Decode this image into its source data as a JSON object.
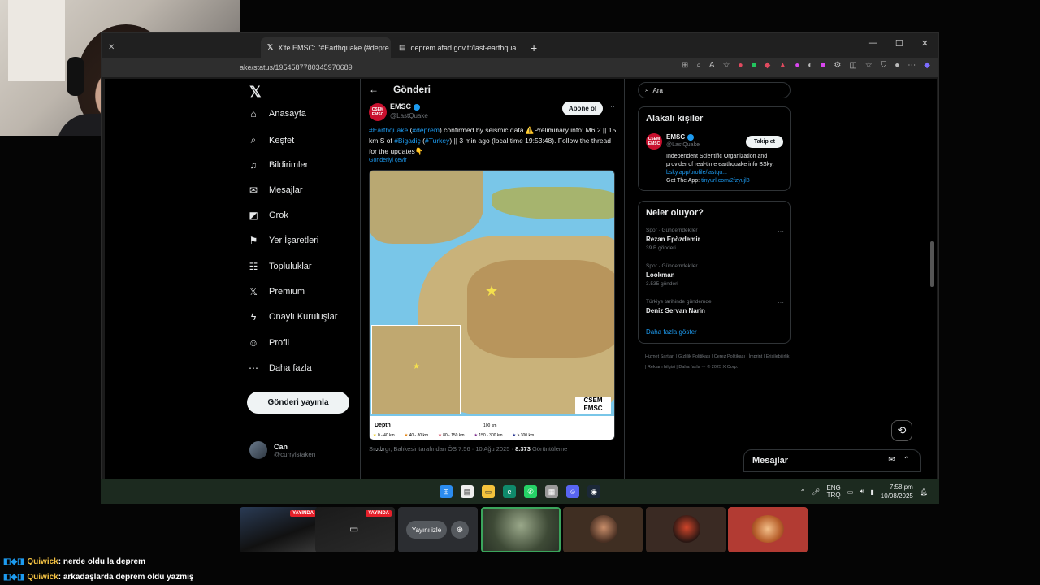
{
  "browser": {
    "tabs": [
      {
        "label": "X'te EMSC: \"#Earthquake (#depre",
        "active": true
      },
      {
        "label": "deprem.afad.gov.tr/last-earthqua",
        "active": false
      }
    ],
    "url": "ake/status/1954587780345970689"
  },
  "x": {
    "nav": [
      {
        "label": "Anasayfa",
        "icon": "home-icon"
      },
      {
        "label": "Keşfet",
        "icon": "search-icon"
      },
      {
        "label": "Bildirimler",
        "icon": "bell-icon"
      },
      {
        "label": "Mesajlar",
        "icon": "mail-icon"
      },
      {
        "label": "Grok",
        "icon": "grok-icon"
      },
      {
        "label": "Yer İşaretleri",
        "icon": "bookmark-icon"
      },
      {
        "label": "Topluluklar",
        "icon": "people-icon"
      },
      {
        "label": "Premium",
        "icon": "x-logo-icon"
      },
      {
        "label": "Onaylı Kuruluşlar",
        "icon": "lightning-icon"
      },
      {
        "label": "Profil",
        "icon": "person-icon"
      },
      {
        "label": "Daha fazla",
        "icon": "more-circle-icon"
      }
    ],
    "post_button": "Gönderi yayınla",
    "account": {
      "name": "Can",
      "handle": "@curryistaken"
    },
    "header_title": "Gönderi",
    "tweet": {
      "author": "EMSC",
      "handle": "@LastQuake",
      "avatar_text": "CSEM EMSC",
      "follow_label": "Abone ol",
      "text": {
        "tag1": "#Earthquake",
        "tag2": "#deprem",
        "part1": " confirmed by seismic data.⚠️Preliminary info: M6.2 || 15 km S of ",
        "tag3": "#Bigadiç",
        "tag4": "#Turkey",
        "part2": " || 3 min ago (local time 19:53:48). Follow the thread for the updates👇"
      },
      "translate": "Gönderiyi çevir",
      "map": {
        "logo": "CSEM EMSC",
        "legend_title": "Depth",
        "scale": "100 km",
        "legend": [
          "0 - 40 km",
          "40 - 80 km",
          "80 - 150 km",
          "150 - 300 km",
          "> 300 km"
        ]
      },
      "meta_location": "Sındırgı, Balıkesir tarafından ÖS 7:56 · 10 Ağu 2025 · ",
      "views_count": "8.373",
      "views_label": " Görüntüleme"
    },
    "search_placeholder": "Ara",
    "related": {
      "title": "Alakalı kişiler",
      "name": "EMSC",
      "handle": "@LastQuake",
      "follow_label": "Takip et",
      "bio1": "Independent Scientific Organization and provider of real-time earthquake info BSky: ",
      "bio_link": "bsky.app/profile/lastqu...",
      "bio2": "Get The App: ",
      "app_link": "tinyurl.com/2fzyujl8"
    },
    "trends": {
      "title": "Neler oluyor?",
      "items": [
        {
          "category": "Spor · Gündemdekiler",
          "name": "Rezan Epözdemir",
          "count": "39 B gönderi"
        },
        {
          "category": "Spor · Gündemdekiler",
          "name": "Lookman",
          "count": "3.535 gönderi"
        },
        {
          "category": "Türkiye tarihinde gündemde",
          "name": "Deniz Servan Narin",
          "count": ""
        }
      ],
      "show_more": "Daha fazla göster"
    },
    "footer": "Hizmet Şartları | Gizlilik Politikası | Çerez Politikası | İmprint | Erişilebilirlik | Reklam bilgisi | Daha fazla ··· © 2025 X Corp.",
    "messages": "Mesajlar"
  },
  "taskbar": {
    "lang1": "ENG",
    "lang2": "TRQ",
    "time": "7:58 pm",
    "date": "10/08/2025"
  },
  "stream": {
    "live_label": "YAYINDA",
    "watch_label": "Yayını izle"
  },
  "chat": [
    {
      "user": "Quiwick",
      "message": ": nerde oldu la deprem"
    },
    {
      "user": "Quiwick",
      "message": ": arkadaşlarda deprem oldu yazmış"
    }
  ]
}
